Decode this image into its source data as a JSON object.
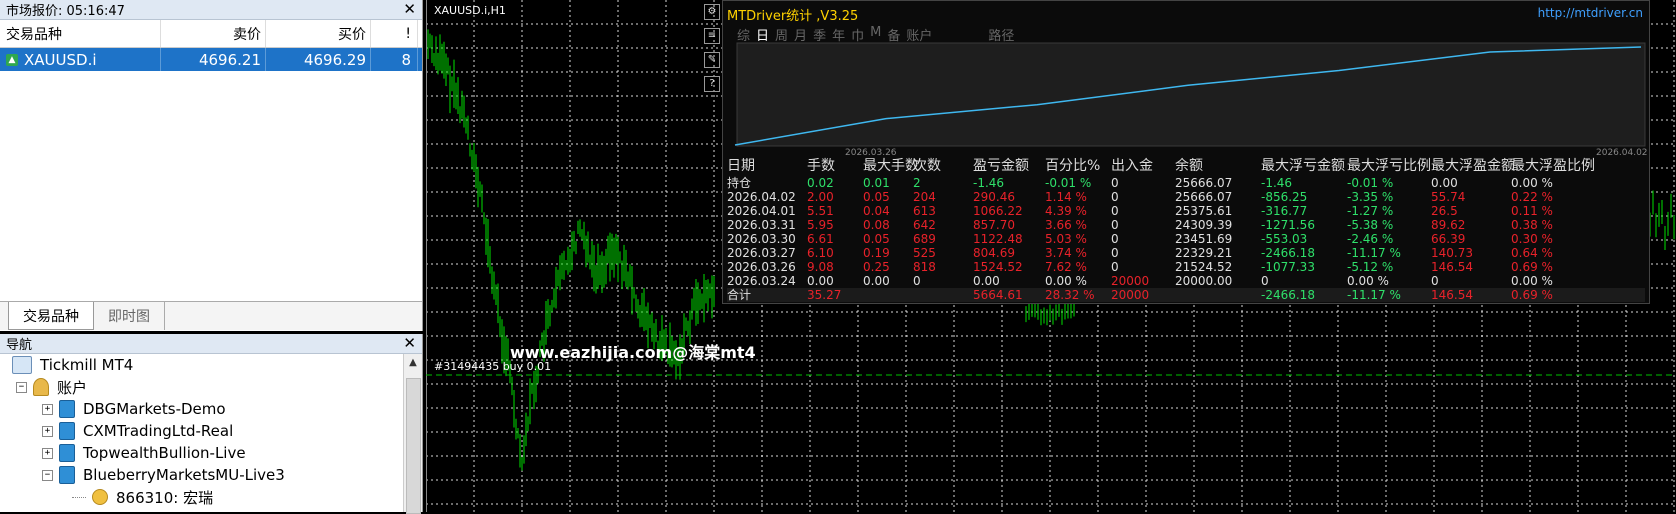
{
  "market_watch": {
    "title": "市场报价: 05:16:47",
    "columns": [
      "交易品种",
      "卖价",
      "买价",
      "!"
    ],
    "rows": [
      {
        "symbol": "XAUUSD.i",
        "bid": "4696.21",
        "ask": "4696.29",
        "spread": "8"
      }
    ],
    "tabs": [
      "交易品种",
      "即时图"
    ]
  },
  "navigator": {
    "title": "导航",
    "items": [
      {
        "label": "Tickmill MT4"
      },
      {
        "label": "账户"
      },
      {
        "label": "DBGMarkets-Demo"
      },
      {
        "label": "CXMTradingLtd-Real"
      },
      {
        "label": "TopwealthBullion-Live"
      },
      {
        "label": "BlueberryMarketsMU-Live3"
      },
      {
        "label": "866310: 宏瑞"
      }
    ]
  },
  "chart": {
    "title": "XAUUSD.i,H1",
    "watermark": "www.eazhijia.com@海棠mt4",
    "order_label": "#31494435 buy 0.01",
    "colors": {
      "bg": "#000000",
      "candle": "#00ff00",
      "grid": "#ffffff",
      "order_line": "#00c000"
    }
  },
  "stats_panel": {
    "title": "MTDriver统计 ,V3.25",
    "url": "http://mtdriver.cn",
    "tabs": [
      "综",
      "日",
      "周",
      "月",
      "季",
      "年",
      "巾",
      "M",
      "备",
      "账户",
      "路径"
    ],
    "active_tab": "日",
    "equity_chart": {
      "x_start_label": "2026.03.26",
      "x_end_label": "2026.04.02",
      "line_color": "#3fb8f0"
    },
    "columns": [
      "日期",
      "手数",
      "最大手数",
      "次数",
      "盈亏金额",
      "百分比%",
      "出入金",
      "余额",
      "最大浮亏金额",
      "最大浮亏比例",
      "最大浮盈金额",
      "最大浮盈比例"
    ],
    "rows": [
      {
        "cells": [
          "持仓",
          "0.02",
          "0.01",
          "2",
          "-1.46",
          "-0.01 %",
          "0",
          "25666.07",
          "-1.46",
          "-0.01 %",
          "0.00",
          "0.00 %"
        ],
        "colors": [
          "w",
          "g",
          "g",
          "g",
          "g",
          "g",
          "w",
          "w",
          "g",
          "g",
          "w",
          "w"
        ]
      },
      {
        "cells": [
          "2026.04.02",
          "2.00",
          "0.05",
          "204",
          "290.46",
          "1.14 %",
          "0",
          "25666.07",
          "-856.25",
          "-3.35 %",
          "55.74",
          "0.22 %"
        ],
        "colors": [
          "w",
          "r",
          "r",
          "r",
          "r",
          "r",
          "w",
          "w",
          "g",
          "g",
          "r",
          "r"
        ]
      },
      {
        "cells": [
          "2026.04.01",
          "5.51",
          "0.04",
          "613",
          "1066.22",
          "4.39 %",
          "0",
          "25375.61",
          "-316.77",
          "-1.27 %",
          "26.5",
          "0.11 %"
        ],
        "colors": [
          "w",
          "r",
          "r",
          "r",
          "r",
          "r",
          "w",
          "w",
          "g",
          "g",
          "r",
          "r"
        ]
      },
      {
        "cells": [
          "2026.03.31",
          "5.95",
          "0.08",
          "642",
          "857.70",
          "3.66 %",
          "0",
          "24309.39",
          "-1271.56",
          "-5.38 %",
          "89.62",
          "0.38 %"
        ],
        "colors": [
          "w",
          "r",
          "r",
          "r",
          "r",
          "r",
          "w",
          "w",
          "g",
          "g",
          "r",
          "r"
        ]
      },
      {
        "cells": [
          "2026.03.30",
          "6.61",
          "0.05",
          "689",
          "1122.48",
          "5.03 %",
          "0",
          "23451.69",
          "-553.03",
          "-2.46 %",
          "66.39",
          "0.30 %"
        ],
        "colors": [
          "w",
          "r",
          "r",
          "r",
          "r",
          "r",
          "w",
          "w",
          "g",
          "g",
          "r",
          "r"
        ]
      },
      {
        "cells": [
          "2026.03.27",
          "6.10",
          "0.19",
          "525",
          "804.69",
          "3.74 %",
          "0",
          "22329.21",
          "-2466.18",
          "-11.17 %",
          "140.73",
          "0.64 %"
        ],
        "colors": [
          "w",
          "r",
          "r",
          "r",
          "r",
          "r",
          "w",
          "w",
          "g",
          "g",
          "r",
          "r"
        ]
      },
      {
        "cells": [
          "2026.03.26",
          "9.08",
          "0.25",
          "818",
          "1524.52",
          "7.62 %",
          "0",
          "21524.52",
          "-1077.33",
          "-5.12 %",
          "146.54",
          "0.69 %"
        ],
        "colors": [
          "w",
          "r",
          "r",
          "r",
          "r",
          "r",
          "w",
          "w",
          "g",
          "g",
          "r",
          "r"
        ]
      },
      {
        "cells": [
          "2026.03.24",
          "0.00",
          "0.00",
          "0",
          "0.00",
          "0.00 %",
          "20000",
          "20000.00",
          "0",
          "0.00 %",
          "0",
          "0.00 %"
        ],
        "colors": [
          "w",
          "w",
          "w",
          "w",
          "w",
          "w",
          "r",
          "w",
          "w",
          "w",
          "w",
          "w"
        ]
      }
    ],
    "total": {
      "cells": [
        "合计",
        "35.27",
        "",
        "",
        "5664.61",
        "28.32 %",
        "20000",
        "",
        "-2466.18",
        "-11.17 %",
        "146.54",
        "0.69 %"
      ],
      "colors": [
        "w",
        "r",
        "w",
        "w",
        "r",
        "r",
        "r",
        "w",
        "g",
        "g",
        "r",
        "r"
      ]
    }
  }
}
